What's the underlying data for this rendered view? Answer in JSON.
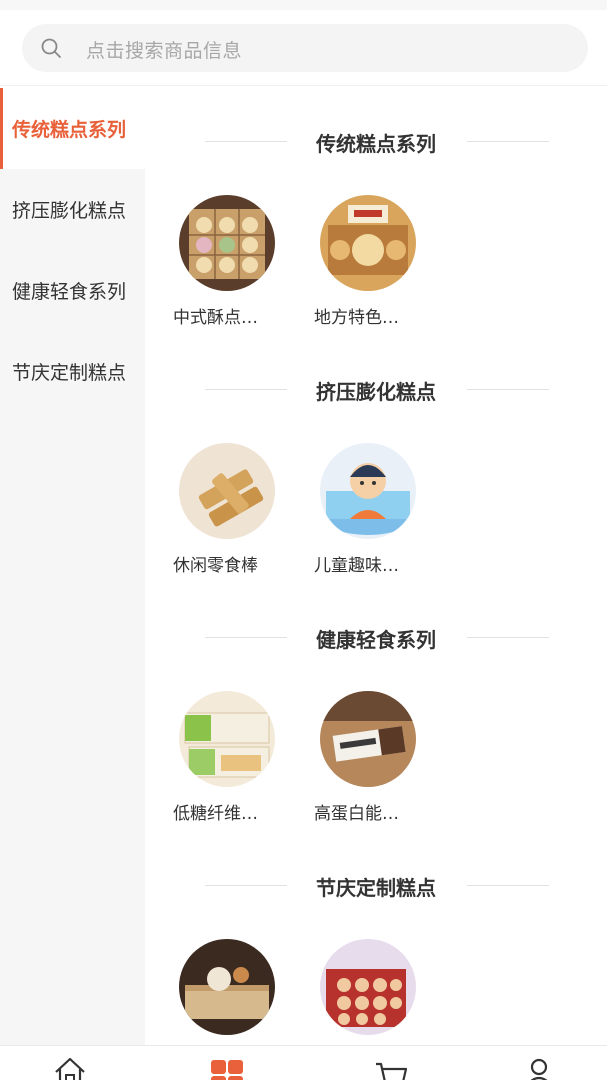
{
  "search": {
    "placeholder": "点击搜索商品信息"
  },
  "sidebar": {
    "items": [
      {
        "label": "传统糕点系列",
        "active": true
      },
      {
        "label": "挤压膨化糕点",
        "active": false
      },
      {
        "label": "健康轻食系列",
        "active": false
      },
      {
        "label": "节庆定制糕点",
        "active": false
      }
    ]
  },
  "sections": [
    {
      "title": "传统糕点系列",
      "products": [
        {
          "name": "中式酥点…"
        },
        {
          "name": "地方特色…"
        }
      ]
    },
    {
      "title": "挤压膨化糕点",
      "products": [
        {
          "name": "休闲零食棒"
        },
        {
          "name": "儿童趣味…"
        }
      ]
    },
    {
      "title": "健康轻食系列",
      "products": [
        {
          "name": "低糖纤维…"
        },
        {
          "name": "高蛋白能…"
        }
      ]
    },
    {
      "title": "节庆定制糕点",
      "products": [
        {
          "name": ""
        },
        {
          "name": ""
        }
      ]
    }
  ],
  "tabbar": {
    "tabs": [
      {
        "icon": "home-icon",
        "active": false
      },
      {
        "icon": "category-icon",
        "active": true
      },
      {
        "icon": "cart-icon",
        "active": false
      },
      {
        "icon": "user-icon",
        "active": false
      }
    ]
  },
  "colors": {
    "accent": "#e8613a",
    "sidebar_bg": "#f6f6f6",
    "search_bg": "#f4f4f4"
  }
}
